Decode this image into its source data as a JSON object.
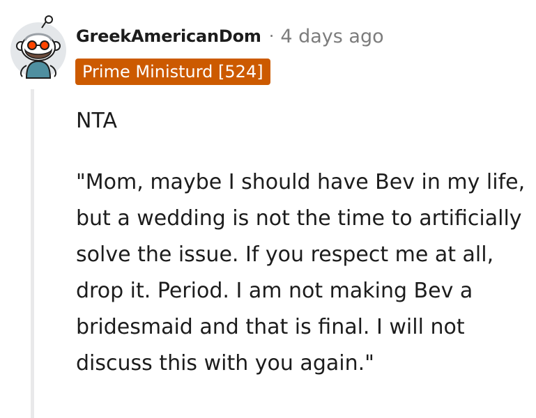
{
  "comment": {
    "username": "GreekAmericanDom",
    "separator": "·",
    "timestamp": "4 days ago",
    "flair": "Prime Ministurd [524]",
    "paragraphs": [
      "NTA",
      "\"Mom, maybe I should have Bev in my life, but a wedding is not the time to artificially solve the issue. If you respect me at all, drop it. Period. I am not making Bev a bridesmaid and that is final. I will not discuss this with you again.\""
    ]
  },
  "colors": {
    "flair_background": "#cc5a00",
    "text": "#1c1c1c",
    "meta": "#7c7c7c",
    "thread_line": "#e9e9ea"
  },
  "icons": {
    "avatar": "snoo-avatar-bearded-glasses"
  }
}
